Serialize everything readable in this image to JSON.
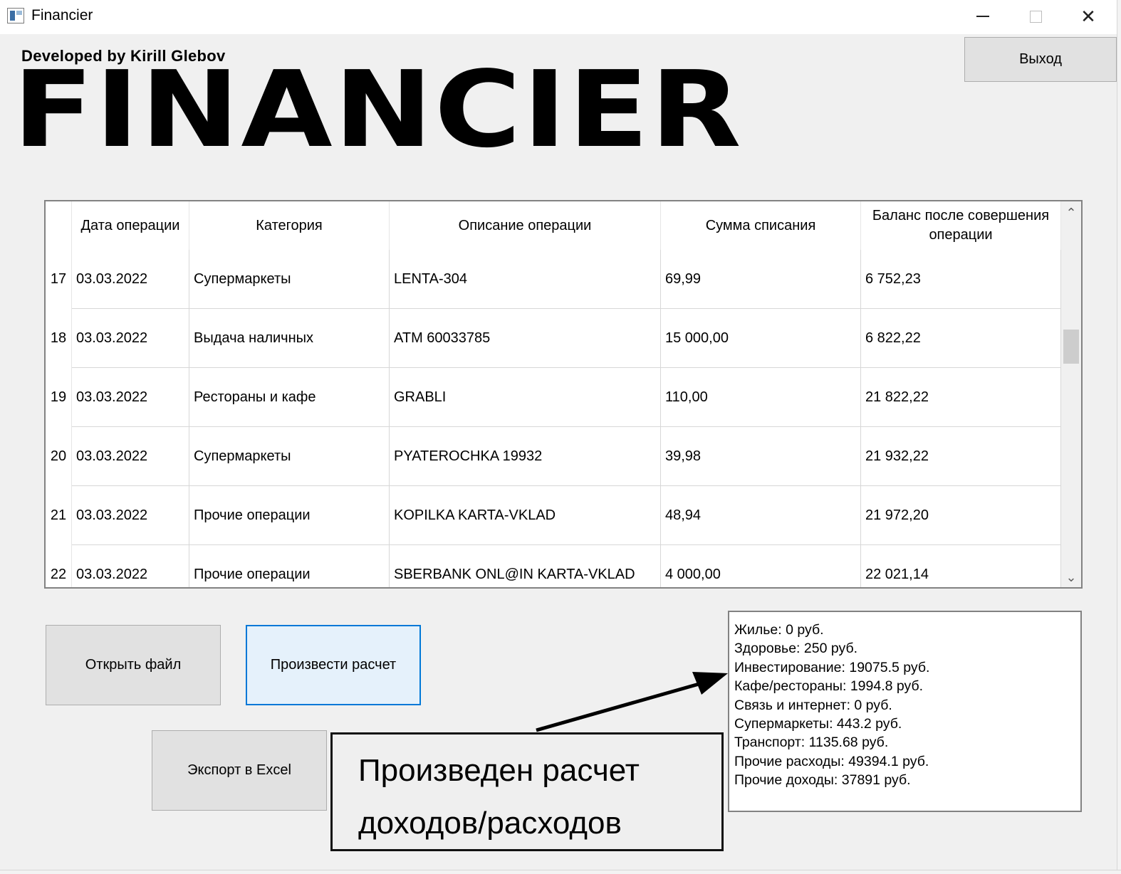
{
  "window": {
    "title": "Financier"
  },
  "header": {
    "developer": "Developed by Kirill Glebov",
    "logo": "FINANCIER",
    "exit_label": "Выход"
  },
  "table": {
    "columns": [
      "Дата операции",
      "Категория",
      "Описание операции",
      "Сумма списания",
      "Баланс после совершения операции"
    ],
    "rows": [
      {
        "n": "17",
        "date": "03.03.2022",
        "category": "Супермаркеты",
        "description": "LENTA-304",
        "amount": "69,99",
        "balance": "6 752,23"
      },
      {
        "n": "18",
        "date": "03.03.2022",
        "category": "Выдача наличных",
        "description": "ATM 60033785",
        "amount": "15 000,00",
        "balance": "6 822,22"
      },
      {
        "n": "19",
        "date": "03.03.2022",
        "category": "Рестораны и кафе",
        "description": "GRABLI",
        "amount": "110,00",
        "balance": "21 822,22"
      },
      {
        "n": "20",
        "date": "03.03.2022",
        "category": "Супермаркеты",
        "description": "PYATEROCHKA 19932",
        "amount": "39,98",
        "balance": "21 932,22"
      },
      {
        "n": "21",
        "date": "03.03.2022",
        "category": "Прочие операции",
        "description": "KOPILKA KARTA-VKLAD",
        "amount": "48,94",
        "balance": "21 972,20"
      },
      {
        "n": "22",
        "date": "03.03.2022",
        "category": "Прочие операции",
        "description": "SBERBANK ONL@IN KARTA-VKLAD",
        "amount": "4 000,00",
        "balance": "22 021,14"
      }
    ]
  },
  "buttons": {
    "open_file": "Открыть файл",
    "calculate": "Произвести расчет",
    "export_excel": "Экспорт в Excel"
  },
  "summary": {
    "lines": [
      "Жилье: 0 руб.",
      "Здоровье: 250 руб.",
      "Инвестирование: 19075.5 руб.",
      "Кафе/рестораны: 1994.8 руб.",
      "Связь и интернет: 0 руб.",
      "Супермаркеты: 443.2 руб.",
      "Транспорт: 1135.68 руб.",
      "Прочие расходы: 49394.1 руб.",
      "Прочие доходы: 37891 руб."
    ]
  },
  "annotation": {
    "lines": [
      "Произведен расчет",
      "доходов/расходов"
    ]
  },
  "icons": {
    "app": "app-window-icon",
    "minimize": "minimize-icon",
    "maximize": "maximize-icon",
    "close": "close-icon",
    "scroll_up": "chevron-up-icon",
    "scroll_down": "chevron-down-icon"
  },
  "colors": {
    "accent": "#0078d7",
    "selected_button_bg": "#e5f1fb",
    "client_bg": "#f0f0f0"
  }
}
